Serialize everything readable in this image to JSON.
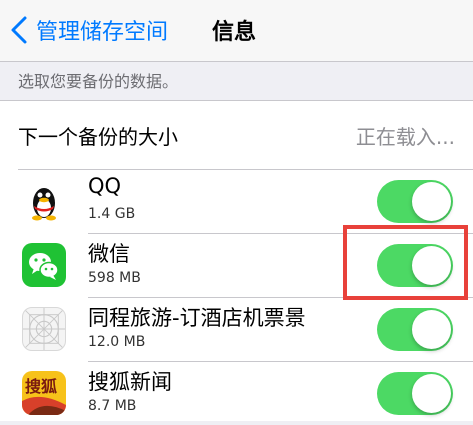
{
  "navbar": {
    "back_label": "管理储存空间",
    "title": "信息"
  },
  "hint": "选取您要备份的数据。",
  "backup_header": {
    "label": "下一个备份的大小",
    "value": "正在载入..."
  },
  "apps": [
    {
      "name": "QQ",
      "size": "1.4 GB",
      "enabled": true
    },
    {
      "name": "微信",
      "size": "598 MB",
      "enabled": true
    },
    {
      "name": "同程旅游-订酒店机票景",
      "size": "12.0 MB",
      "enabled": true
    },
    {
      "name": "搜狐新闻",
      "size": "8.7 MB",
      "enabled": true
    }
  ],
  "icon_text": {
    "sohu": "搜狐"
  },
  "colors": {
    "accent": "#007aff",
    "toggle_on": "#4cd964",
    "highlight": "#e8413a"
  }
}
